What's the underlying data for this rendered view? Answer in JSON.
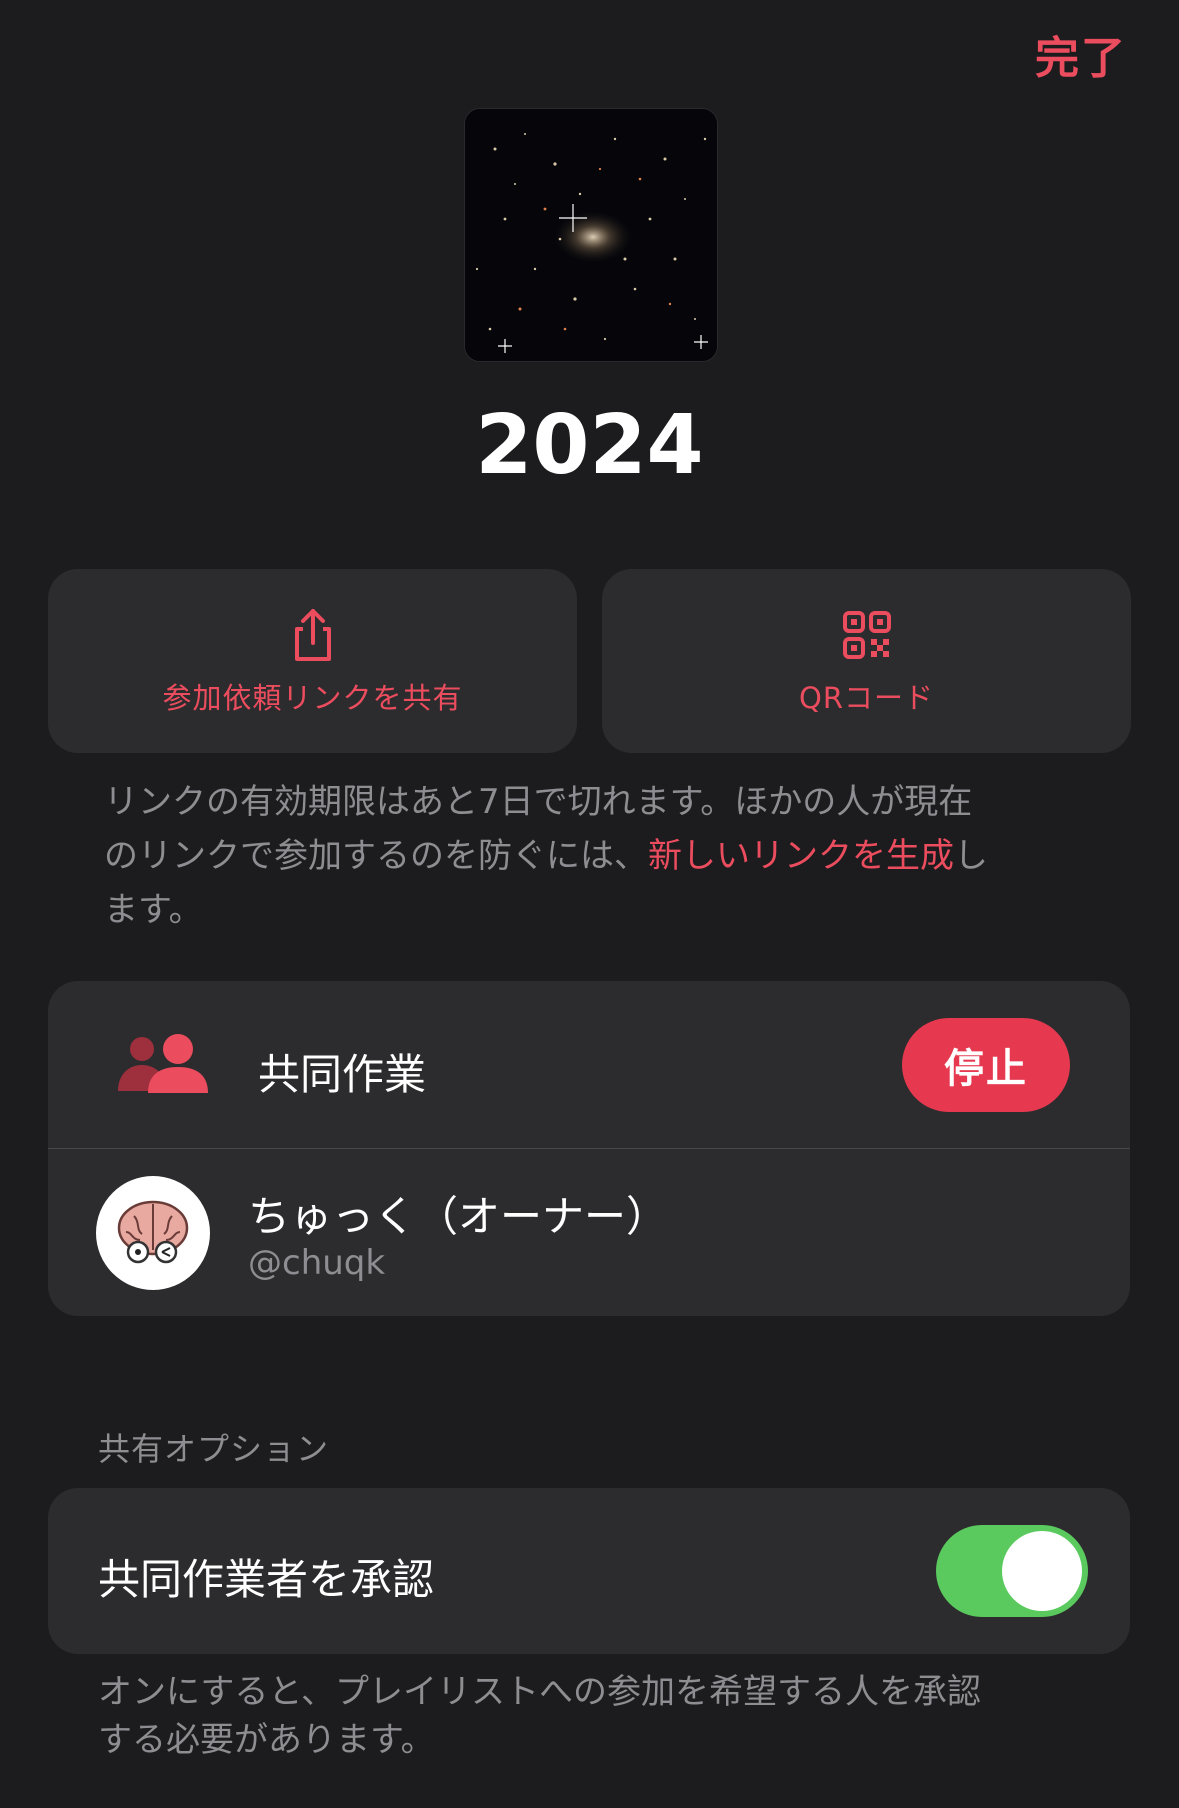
{
  "header": {
    "done_label": "完了"
  },
  "playlist": {
    "title": "2024"
  },
  "actions": {
    "share_label": "参加依頼リンクを共有",
    "qr_label": "QRコード"
  },
  "link_note": {
    "line1": "リンクの有効期限はあと7日で切れます。ほかの人が現在",
    "line2_prefix": "のリンクで参加するのを防ぐには、",
    "line2_link": "新しいリンクを生成",
    "line2_suffix": "し",
    "line3": "ます。"
  },
  "collaboration": {
    "label": "共同作業",
    "stop_label": "停止",
    "owner_name": "ちゅっく（オーナー）",
    "owner_handle": "@chuqk"
  },
  "options": {
    "section_title": "共有オプション",
    "approve_label": "共同作業者を承認",
    "approve_enabled": true,
    "note_line1": "オンにすると、プレイリストへの参加を希望する人を承認",
    "note_line2": "する必要があります。"
  },
  "colors": {
    "accent": "#eb4d5e",
    "toggle_on": "#5ac95e",
    "card_bg": "#2c2c2e",
    "page_bg": "#1c1c1e"
  }
}
